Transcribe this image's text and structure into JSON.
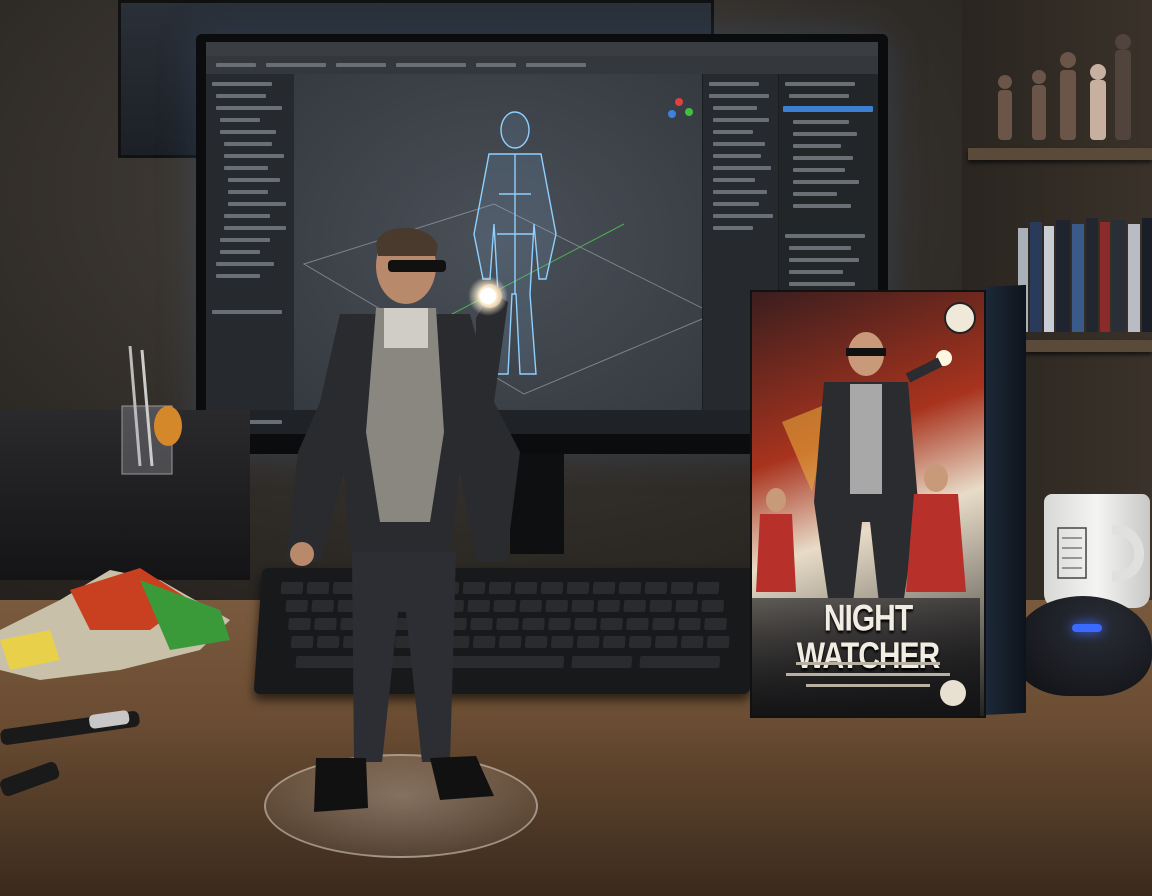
{
  "scene": {
    "box": {
      "title": "NIGHT WATCHER"
    }
  }
}
